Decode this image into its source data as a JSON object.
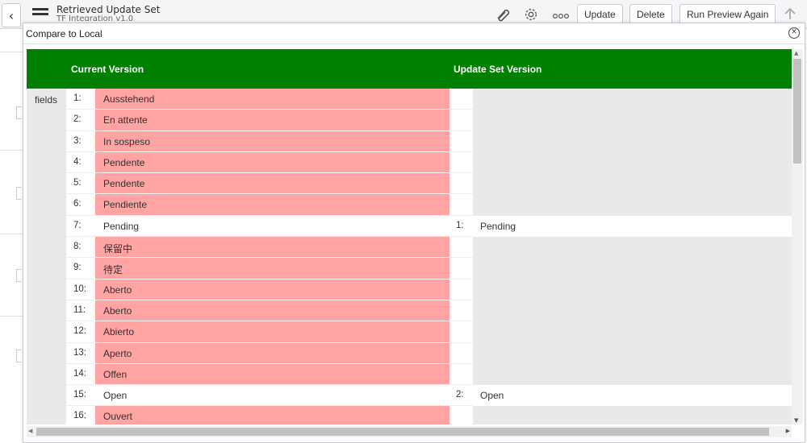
{
  "page_header": {
    "title": "Retrieved Update Set",
    "subtitle": "TF Integration v1.0",
    "buttons": [
      "Update",
      "Delete",
      "Run Preview Again"
    ],
    "icons": [
      "back-icon",
      "menu-icon",
      "attachment-icon",
      "gear-icon",
      "more-icon",
      "arrow-up-icon"
    ]
  },
  "modal": {
    "title": "Compare to Local",
    "close_symbol": "✕",
    "column_current": "Current Version",
    "column_update": "Update Set Version",
    "field_label": "fields",
    "rows": [
      {
        "ln": "1:",
        "text": "Ausstehend",
        "state": "removed",
        "rln": "",
        "rtext": ""
      },
      {
        "ln": "2:",
        "text": "En attente",
        "state": "removed",
        "rln": "",
        "rtext": ""
      },
      {
        "ln": "3:",
        "text": "In sospeso",
        "state": "removed",
        "rln": "",
        "rtext": ""
      },
      {
        "ln": "4:",
        "text": "Pendente",
        "state": "removed",
        "rln": "",
        "rtext": ""
      },
      {
        "ln": "5:",
        "text": "Pendente",
        "state": "removed",
        "rln": "",
        "rtext": ""
      },
      {
        "ln": "6:",
        "text": "Pendiente",
        "state": "removed",
        "rln": "",
        "rtext": ""
      },
      {
        "ln": "7:",
        "text": "Pending",
        "state": "unchanged",
        "rln": "1:",
        "rtext": "Pending"
      },
      {
        "ln": "8:",
        "text": "保留中",
        "state": "removed",
        "rln": "",
        "rtext": ""
      },
      {
        "ln": "9:",
        "text": "待定",
        "state": "removed",
        "rln": "",
        "rtext": ""
      },
      {
        "ln": "10:",
        "text": "Aberto",
        "state": "removed",
        "rln": "",
        "rtext": ""
      },
      {
        "ln": "11:",
        "text": "Aberto",
        "state": "removed",
        "rln": "",
        "rtext": ""
      },
      {
        "ln": "12:",
        "text": "Abierto",
        "state": "removed",
        "rln": "",
        "rtext": ""
      },
      {
        "ln": "13:",
        "text": "Aperto",
        "state": "removed",
        "rln": "",
        "rtext": ""
      },
      {
        "ln": "14:",
        "text": "Offen",
        "state": "removed",
        "rln": "",
        "rtext": ""
      },
      {
        "ln": "15:",
        "text": "Open",
        "state": "unchanged",
        "rln": "2:",
        "rtext": "Open"
      },
      {
        "ln": "16:",
        "text": "Ouvert",
        "state": "removed",
        "rln": "",
        "rtext": ""
      }
    ]
  },
  "colors": {
    "header_green": "#008000",
    "removed_red": "#ffa3a3",
    "empty_gray": "#e8e9eb"
  }
}
